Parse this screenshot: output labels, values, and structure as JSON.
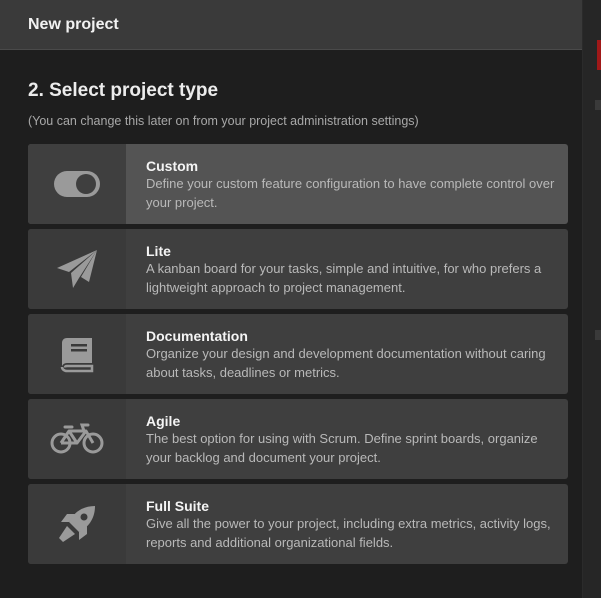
{
  "modal": {
    "title": "New project"
  },
  "step": {
    "title": "2. Select project type",
    "subtitle": "(You can change this later on from your project administration settings)"
  },
  "options": [
    {
      "name": "Custom",
      "description": "Define your custom feature configuration to have complete control over your project.",
      "icon": "toggle-icon",
      "selected": true
    },
    {
      "name": "Lite",
      "description": "A kanban board for your tasks, simple and intuitive, for who prefers a lightweight approach to project management.",
      "icon": "paper-plane-icon",
      "selected": false
    },
    {
      "name": "Documentation",
      "description": "Organize your design and development documentation without caring about tasks, deadlines or metrics.",
      "icon": "book-icon",
      "selected": false
    },
    {
      "name": "Agile",
      "description": "The best option for using with Scrum. Define sprint boards, organize your backlog and document your project.",
      "icon": "bicycle-icon",
      "selected": false
    },
    {
      "name": "Full Suite",
      "description": "Give all the power to your project, including extra metrics, activity logs, reports and additional organizational fields.",
      "icon": "rocket-icon",
      "selected": false
    }
  ],
  "colors": {
    "card": "#3f3f3f",
    "card_selected": "#545454",
    "icon": "#9a9a9a"
  }
}
